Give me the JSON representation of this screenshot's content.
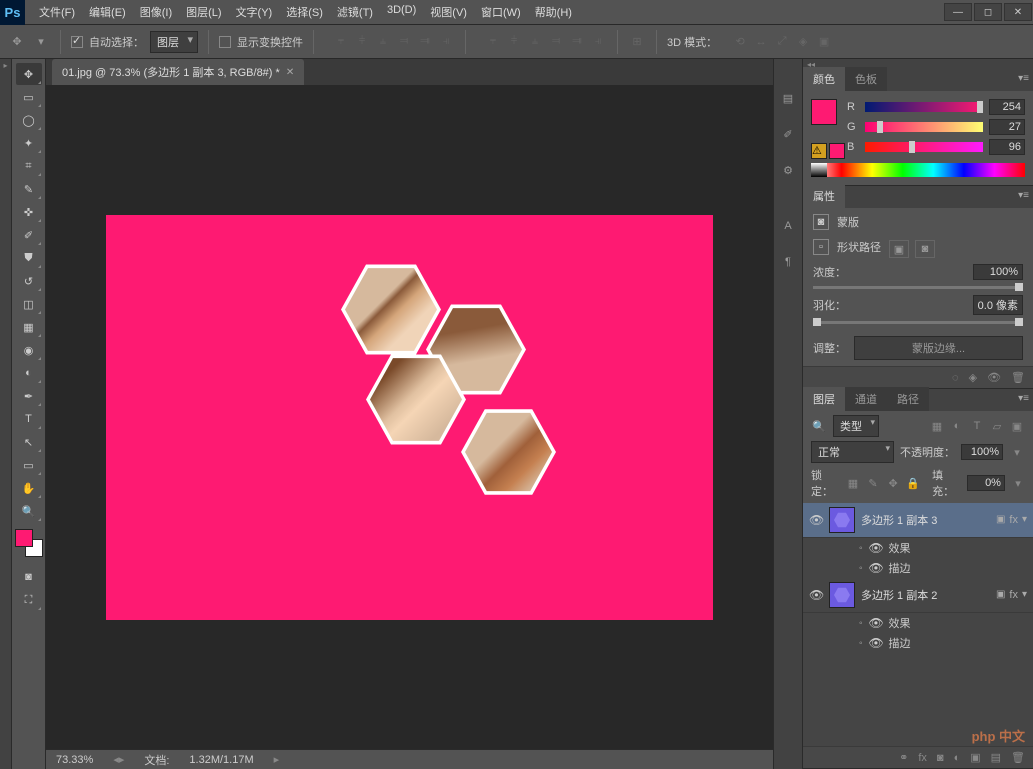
{
  "app": {
    "logo": "Ps"
  },
  "menu": {
    "file": "文件(F)",
    "edit": "编辑(E)",
    "image": "图像(I)",
    "layer": "图层(L)",
    "type": "文字(Y)",
    "select": "选择(S)",
    "filter": "滤镜(T)",
    "threed": "3D(D)",
    "view": "视图(V)",
    "window": "窗口(W)",
    "help": "帮助(H)"
  },
  "options": {
    "auto_select": "自动选择：",
    "target": "图层",
    "show_transform": "显示变换控件",
    "mode3d_label": "3D 模式："
  },
  "doc": {
    "tab": "01.jpg @ 73.3% (多边形 1 副本 3, RGB/8#) *"
  },
  "status": {
    "zoom": "73.33%",
    "doc_label": "文档:",
    "doc_size": "1.32M/1.17M"
  },
  "color_panel": {
    "tab_color": "颜色",
    "tab_swatches": "色板",
    "r_label": "R",
    "g_label": "G",
    "b_label": "B",
    "r": "254",
    "g": "27",
    "b": "96"
  },
  "props_panel": {
    "tab": "属性",
    "mask_title": "蒙版",
    "shape_path": "形状路径",
    "density_label": "浓度：",
    "density": "100%",
    "feather_label": "羽化：",
    "feather": "0.0 像素",
    "adjust_label": "调整：",
    "mask_edge": "蒙版边缘..."
  },
  "layers_panel": {
    "tab_layers": "图层",
    "tab_channels": "通道",
    "tab_paths": "路径",
    "kind": "类型",
    "blend": "正常",
    "opacity_label": "不透明度：",
    "opacity": "100%",
    "lock_label": "锁定：",
    "fill_label": "填充：",
    "fill": "0%",
    "layers": [
      {
        "name": "多边形 1 副本 3",
        "fx_label": "fx"
      },
      {
        "name": "多边形 1 副本 2",
        "fx_label": "fx"
      }
    ],
    "effects": "效果",
    "stroke": "描边"
  },
  "watermark": "php 中文"
}
